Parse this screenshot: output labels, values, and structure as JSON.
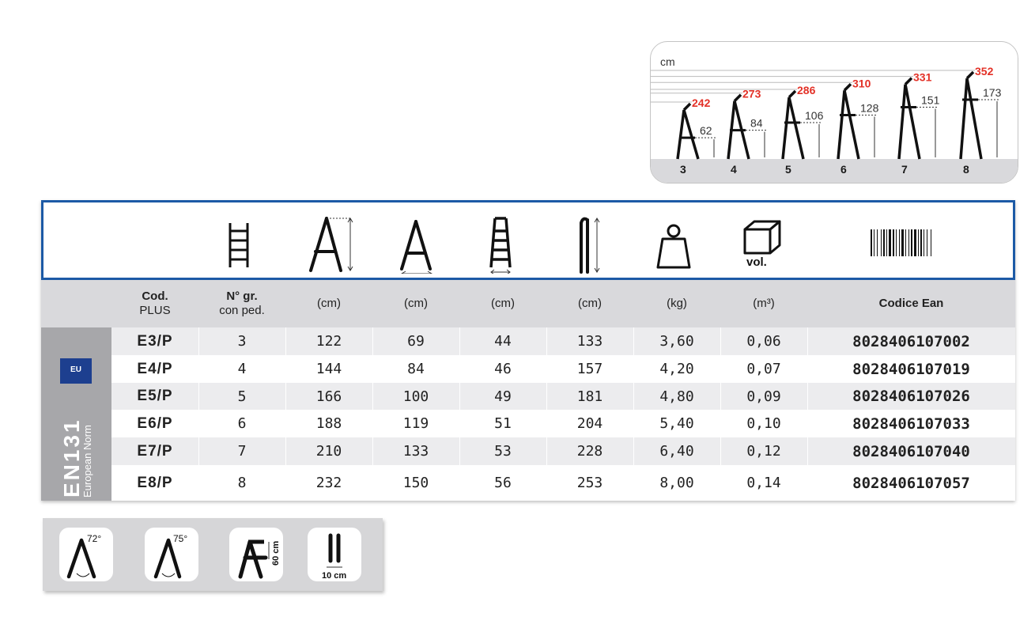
{
  "height_chart": {
    "unit": "cm",
    "ladders": [
      {
        "steps": "3",
        "total_height": "242",
        "step_height": "62"
      },
      {
        "steps": "4",
        "total_height": "273",
        "step_height": "84"
      },
      {
        "steps": "5",
        "total_height": "286",
        "step_height": "106"
      },
      {
        "steps": "6",
        "total_height": "310",
        "step_height": "128"
      },
      {
        "steps": "7",
        "total_height": "331",
        "step_height": "151"
      },
      {
        "steps": "8",
        "total_height": "352",
        "step_height": "173"
      }
    ]
  },
  "icon_header": {
    "icons": [
      "ladder-steps-icon",
      "ladder-height-icon",
      "ladder-base-width-icon",
      "ladder-step-width-icon",
      "ladder-closed-length-icon",
      "weight-icon",
      "volume-box-icon",
      "barcode-icon"
    ],
    "volume_label": "vol."
  },
  "units": {
    "cod_line1": "Cod.",
    "cod_line2": "PLUS",
    "steps_line1": "N° gr.",
    "steps_line2": "con ped.",
    "col3": "(cm)",
    "col4": "(cm)",
    "col5": "(cm)",
    "col6": "(cm)",
    "col7": "(kg)",
    "col8": "(m³)",
    "ean": "Codice Ean"
  },
  "norm": {
    "badge": "EU",
    "code": "EN131",
    "subtitle": "European Norm"
  },
  "rows": [
    [
      "E3/P",
      "3",
      "122",
      "69",
      "44",
      "133",
      "3,60",
      "0,06",
      "8028406107002"
    ],
    [
      "E4/P",
      "4",
      "144",
      "84",
      "46",
      "157",
      "4,20",
      "0,07",
      "8028406107019"
    ],
    [
      "E5/P",
      "5",
      "166",
      "100",
      "49",
      "181",
      "4,80",
      "0,09",
      "8028406107026"
    ],
    [
      "E6/P",
      "6",
      "188",
      "119",
      "51",
      "204",
      "5,40",
      "0,10",
      "8028406107033"
    ],
    [
      "E7/P",
      "7",
      "210",
      "133",
      "53",
      "228",
      "6,40",
      "0,12",
      "8028406107040"
    ],
    [
      "E8/P",
      "8",
      "232",
      "150",
      "56",
      "253",
      "8,00",
      "0,14",
      "8028406107057"
    ]
  ],
  "features": {
    "angle1": "72°",
    "angle2": "75°",
    "platform": "60 cm",
    "thickness": "10 cm"
  }
}
